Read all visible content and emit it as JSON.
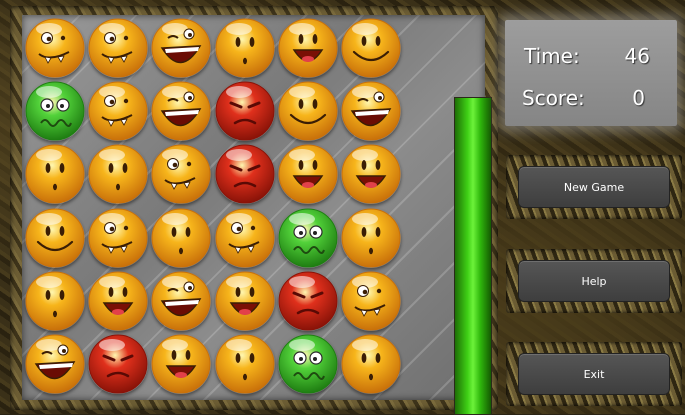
{
  "game": {
    "grid": [
      [
        "crazy",
        "crazy",
        "laugh",
        "oh",
        "grin",
        "smile"
      ],
      [
        "sick",
        "crazy",
        "laugh",
        "angry",
        "smile",
        "laugh"
      ],
      [
        "oh",
        "oh",
        "crazy",
        "angry",
        "grin",
        "grin"
      ],
      [
        "smile",
        "crazy",
        "oh",
        "crazy",
        "sick",
        "oh"
      ],
      [
        "oh",
        "grin",
        "laugh",
        "grin",
        "angry",
        "crazy"
      ],
      [
        "laugh",
        "angry",
        "grin",
        "oh",
        "sick",
        "oh"
      ]
    ],
    "timer_fill": 1.0,
    "colors": {
      "yellow": "#f7b51b",
      "green": "#52d23a",
      "red": "#e0301c"
    }
  },
  "info": {
    "time_label": "Time:",
    "time_value": "46",
    "score_label": "Score:",
    "score_value": "0"
  },
  "buttons": {
    "new_game": "New Game",
    "help": "Help",
    "exit": "Exit"
  }
}
